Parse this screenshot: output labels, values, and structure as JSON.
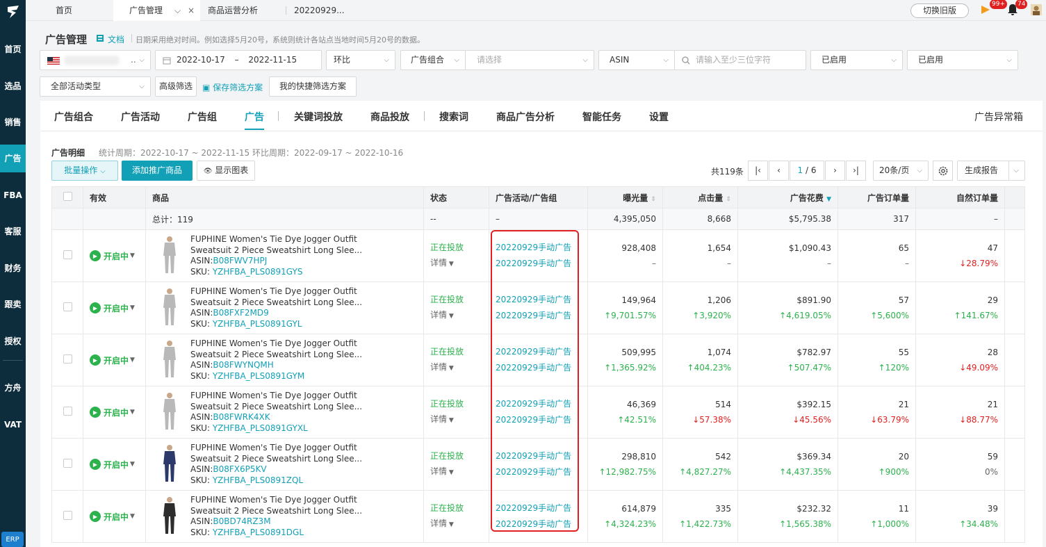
{
  "sidebar": {
    "items": [
      "首页",
      "选品",
      "销售",
      "广告",
      "FBA",
      "客服",
      "财务",
      "跟卖",
      "授权",
      "方舟",
      "VAT"
    ],
    "erp": "ERP"
  },
  "topbar": {
    "tabs": [
      "首页",
      "广告管理",
      "商品运营分析",
      "20220929..."
    ],
    "switch_label": "切换旧版",
    "badge1": "99+",
    "badge2": "74"
  },
  "header": {
    "title": "广告管理",
    "doc_link": "文档",
    "note": "日期采用绝对时间。例如选择5月20号，系统则统计各站点当地时间5月20号的数据。"
  },
  "filters": {
    "date_start": "2022-10-17",
    "date_sep": "–",
    "date_end": "2022-11-15",
    "compare": "环比",
    "group_label": "广告组合",
    "group_placeholder": "请选择",
    "asin_label": "ASIN",
    "search_placeholder": "请输入至少三位字符",
    "status1": "已启用",
    "status2": "已启用",
    "activity_type": "全部活动类型",
    "advanced": "高级筛选",
    "save_plan": "保存筛选方案",
    "my_plan": "我的快捷筛选方案"
  },
  "tabs": [
    "广告组合",
    "广告活动",
    "广告组",
    "广告",
    "关键词投放",
    "商品投放",
    "搜索词",
    "商品广告分析",
    "智能任务",
    "设置"
  ],
  "anomaly": "广告异常箱",
  "details": {
    "title": "广告明细",
    "period": "统计周期：2022-10-17 ~ 2022-11-15 环比周期：2022-09-17 ~ 2022-10-16",
    "batch": "批量操作",
    "add": "添加推广商品",
    "chart": "显示图表",
    "total": "共119条",
    "page": "1",
    "pages": "/ 6",
    "per_page": "20条/页",
    "report": "生成报告"
  },
  "table": {
    "headers": [
      "有效",
      "商品",
      "状态",
      "广告活动/广告组",
      "曝光量",
      "点击量",
      "广告花费",
      "广告订单量",
      "自然订单量"
    ],
    "summary": {
      "label": "总计：119",
      "status": "--",
      "campaign": "–",
      "impressions": "4,395,050",
      "clicks": "8,668",
      "spend": "$5,795.38",
      "orders": "317",
      "natural": "–"
    },
    "rows": [
      {
        "valid": "开启中",
        "title1": "FUPHINE Women's Tie Dye Jogger Outfit",
        "title2": "Sweatsuit 2 Piece Sweatshirt Long Slee...",
        "asin": "B08FWV7HPJ",
        "sku": "YZHFBA_PLS0891GYS",
        "status": "正在投放",
        "detail": "详情",
        "campaign": "20220929手动广告",
        "group": "20220929手动广告",
        "impressions": "928,408",
        "imp_chg": "–",
        "clicks": "1,654",
        "clk_chg": "–",
        "spend": "$1,090.43",
        "sp_chg": "–",
        "orders": "65",
        "ord_chg": "–",
        "natural": "47",
        "nat_chg": "↓28.79%",
        "nat_dir": "down",
        "color": "#b9b9b9"
      },
      {
        "valid": "开启中",
        "title1": "FUPHINE Women's Tie Dye Jogger Outfit",
        "title2": "Sweatsuit 2 Piece Sweatshirt Long Slee...",
        "asin": "B08FXF2MD9",
        "sku": "YZHFBA_PLS0891GYL",
        "status": "正在投放",
        "detail": "详情",
        "campaign": "20220929手动广告",
        "group": "20220929手动广告",
        "impressions": "149,964",
        "imp_chg": "↑9,701.57%",
        "clicks": "1,206",
        "clk_chg": "↑3,920%",
        "spend": "$891.90",
        "sp_chg": "↑4,619.05%",
        "orders": "57",
        "ord_chg": "↑5,600%",
        "natural": "29",
        "nat_chg": "↑141.67%",
        "nat_dir": "up",
        "color": "#b9b9b9"
      },
      {
        "valid": "开启中",
        "title1": "FUPHINE Women's Tie Dye Jogger Outfit",
        "title2": "Sweatsuit 2 Piece Sweatshirt Long Slee...",
        "asin": "B08FWYNQMH",
        "sku": "YZHFBA_PLS0891GYM",
        "status": "正在投放",
        "detail": "详情",
        "campaign": "20220929手动广告",
        "group": "20220929手动广告",
        "impressions": "509,995",
        "imp_chg": "↑1,365.92%",
        "clicks": "1,074",
        "clk_chg": "↑404.23%",
        "spend": "$782.97",
        "sp_chg": "↑507.47%",
        "orders": "55",
        "ord_chg": "↑120%",
        "natural": "28",
        "nat_chg": "↓49.09%",
        "nat_dir": "down",
        "color": "#b9b9b9"
      },
      {
        "valid": "开启中",
        "title1": "FUPHINE Women's Tie Dye Jogger Outfit",
        "title2": "Sweatsuit 2 Piece Sweatshirt Long Slee...",
        "asin": "B08FWRK4XK",
        "sku": "YZHFBA_PLS0891GYXL",
        "status": "正在投放",
        "detail": "详情",
        "campaign": "20220929手动广告",
        "group": "20220929手动广告",
        "impressions": "46,369",
        "imp_chg": "↑42.51%",
        "clicks": "514",
        "clk_chg": "↓57.38%",
        "spend": "$392.15",
        "sp_chg": "↓45.56%",
        "orders": "21",
        "ord_chg": "↓63.79%",
        "natural": "21",
        "nat_chg": "↓88.77%",
        "nat_dir": "down",
        "color": "#b9b9b9"
      },
      {
        "valid": "开启中",
        "title1": "FUPHINE Women's Tie Dye Jogger Outfit",
        "title2": "Sweatsuit 2 Piece Sweatshirt Long Slee...",
        "asin": "B08FX6P5KV",
        "sku": "YZHFBA_PLS0891ZQL",
        "status": "正在投放",
        "detail": "详情",
        "campaign": "20220929手动广告",
        "group": "20220929手动广告",
        "impressions": "298,810",
        "imp_chg": "↑12,982.75%",
        "clicks": "542",
        "clk_chg": "↑4,827.27%",
        "spend": "$369.34",
        "sp_chg": "↑4,437.35%",
        "orders": "20",
        "ord_chg": "↑900%",
        "natural": "59",
        "nat_chg": "0%",
        "nat_dir": "flat",
        "color": "#2b3a6b"
      },
      {
        "valid": "开启中",
        "title1": "FUPHINE Women's Tie Dye Jogger Outfit",
        "title2": "Sweatsuit 2 Piece Sweatshirt Long Slee...",
        "asin": "B0BD74RZ3M",
        "sku": "YZHFBA_PLS0891DGL",
        "status": "正在投放",
        "detail": "详情",
        "campaign": "20220929手动广告",
        "group": "20220929手动广告",
        "impressions": "614,879",
        "imp_chg": "↑4,324.23%",
        "clicks": "335",
        "clk_chg": "↑1,422.73%",
        "spend": "$232.32",
        "sp_chg": "↑1,565.38%",
        "orders": "11",
        "ord_chg": "↑1,000%",
        "natural": "39",
        "nat_chg": "↑34.48%",
        "nat_dir": "up",
        "color": "#2d2d2d"
      }
    ]
  }
}
